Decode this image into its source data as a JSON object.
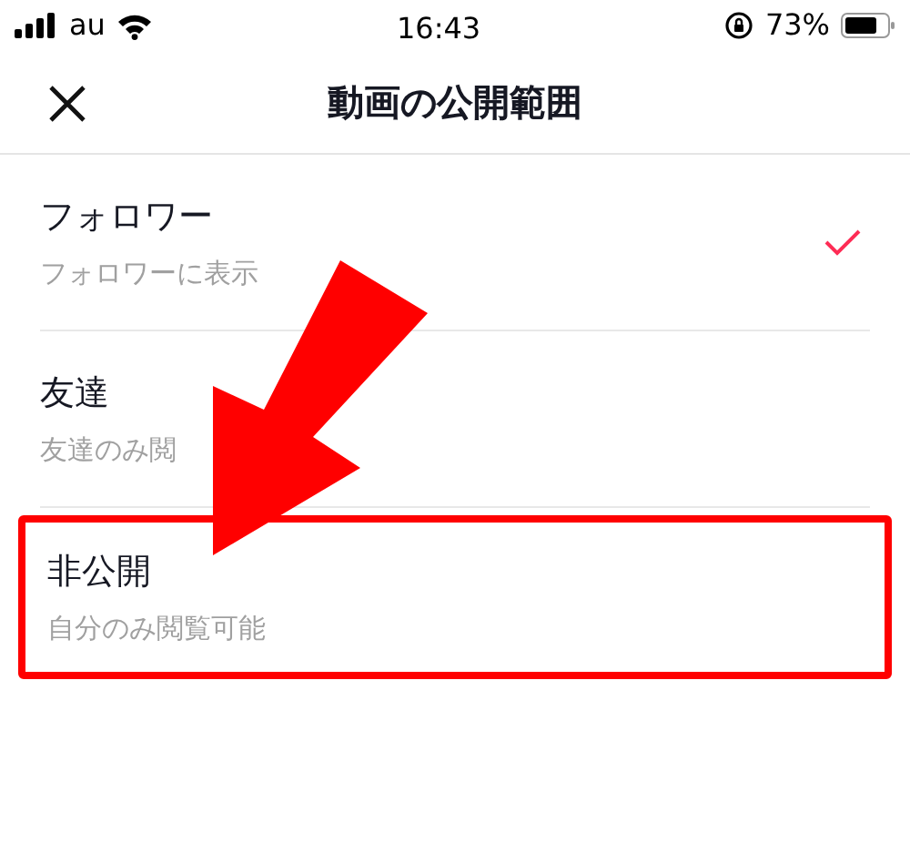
{
  "status_bar": {
    "carrier": "au",
    "time": "16:43",
    "battery": "73%"
  },
  "header": {
    "title": "動画の公開範囲"
  },
  "options": [
    {
      "title": "フォロワー",
      "subtitle": "フォロワーに表示",
      "selected": true,
      "highlighted": false
    },
    {
      "title": "友達",
      "subtitle": "友達のみ閲",
      "selected": false,
      "highlighted": false
    },
    {
      "title": "非公開",
      "subtitle": "自分のみ閲覧可能",
      "selected": false,
      "highlighted": true
    }
  ]
}
